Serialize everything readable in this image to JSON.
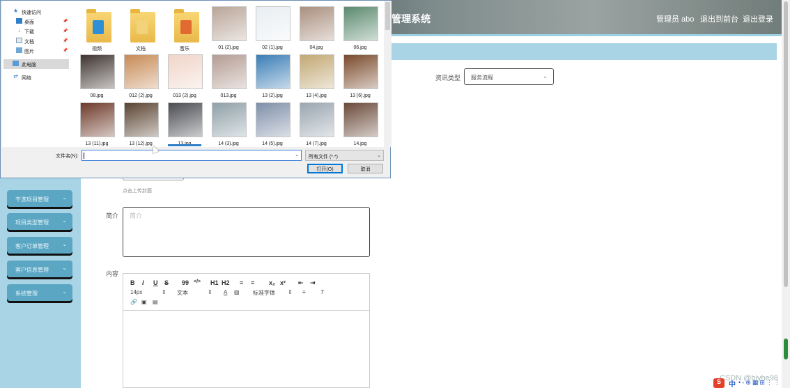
{
  "app": {
    "title": "管理系统",
    "admin_label": "管理员 abo",
    "front_link": "退出到前台",
    "logout_link": "退出登录"
  },
  "sidebar": {
    "items": [
      {
        "label": "干洗项目管理"
      },
      {
        "label": "项目类型管理"
      },
      {
        "label": "客户订单管理"
      },
      {
        "label": "客户信息管理"
      },
      {
        "label": "系统管理"
      }
    ]
  },
  "form": {
    "type_label": "资讯类型",
    "type_value": "服务流程",
    "upload_hint": "点击上传封面",
    "intro_label": "简介",
    "intro_placeholder": "简介",
    "content_label": "内容"
  },
  "editor": {
    "font_size": "14px",
    "paragraph": "文本",
    "font_family": "标准字体",
    "buttons": [
      "B",
      "I",
      "U",
      "S",
      "99",
      "</>",
      "H1",
      "H2",
      "≡",
      "≡",
      "x₂",
      "x²",
      "⇤",
      "⇥"
    ]
  },
  "dialog": {
    "nav": [
      {
        "label": "快速访问",
        "icon": "star-icon"
      },
      {
        "label": "桌面",
        "icon": "desktop-icon"
      },
      {
        "label": "下载",
        "icon": "download-icon"
      },
      {
        "label": "文档",
        "icon": "document-icon"
      },
      {
        "label": "图片",
        "icon": "picture-icon"
      },
      {
        "label": "此电脑",
        "icon": "computer-icon"
      },
      {
        "label": "网络",
        "icon": "network-icon"
      }
    ],
    "files": [
      {
        "name": "视频",
        "kind": "folder",
        "color": "#2e8fd6"
      },
      {
        "name": "文档",
        "kind": "folder",
        "color": "#f2d27a"
      },
      {
        "name": "音乐",
        "kind": "folder",
        "color": "#e06a2f"
      },
      {
        "name": "01 (2).jpg",
        "kind": "image",
        "color": "#b9a598"
      },
      {
        "name": "02 (1).jpg",
        "kind": "image",
        "color": "#e9eef2"
      },
      {
        "name": "04.jpg",
        "kind": "image",
        "color": "#a98f7e"
      },
      {
        "name": "06.jpg",
        "kind": "image",
        "color": "#5b8a6e"
      },
      {
        "name": "08.jpg",
        "kind": "image",
        "color": "#3e3430"
      },
      {
        "name": "012 (2).jpg",
        "kind": "image",
        "color": "#c78a55"
      },
      {
        "name": "013 (2).jpg",
        "kind": "image",
        "color": "#f0d5c9"
      },
      {
        "name": "013.jpg",
        "kind": "image",
        "color": "#b49c93"
      },
      {
        "name": "13 (2).jpg",
        "kind": "image",
        "color": "#3a7db6"
      },
      {
        "name": "13 (4).jpg",
        "kind": "image",
        "color": "#c2a874"
      },
      {
        "name": "13 (6).jpg",
        "kind": "image",
        "color": "#7a4a2c"
      },
      {
        "name": "13 (11).jpg",
        "kind": "image",
        "color": "#6e3a2a"
      },
      {
        "name": "13 (12).jpg",
        "kind": "image",
        "color": "#5a4432"
      },
      {
        "name": "13.jpg",
        "kind": "image",
        "color": "#4a4c52"
      },
      {
        "name": "14 (3).jpg",
        "kind": "image",
        "color": "#8fa0a8"
      },
      {
        "name": "14 (5).jpg",
        "kind": "image",
        "color": "#7f8fa8"
      },
      {
        "name": "14 (7).jpg",
        "kind": "image",
        "color": "#9aa6b0"
      },
      {
        "name": "14.jpg",
        "kind": "image",
        "color": "#6a4a3a"
      }
    ],
    "filename_label": "文件名(N):",
    "filename_value": "",
    "filetype_value": "所有文件 (*.*)",
    "open_button": "打开(O)",
    "cancel_button": "取消"
  },
  "watermark": "CSDN @biyhe98"
}
